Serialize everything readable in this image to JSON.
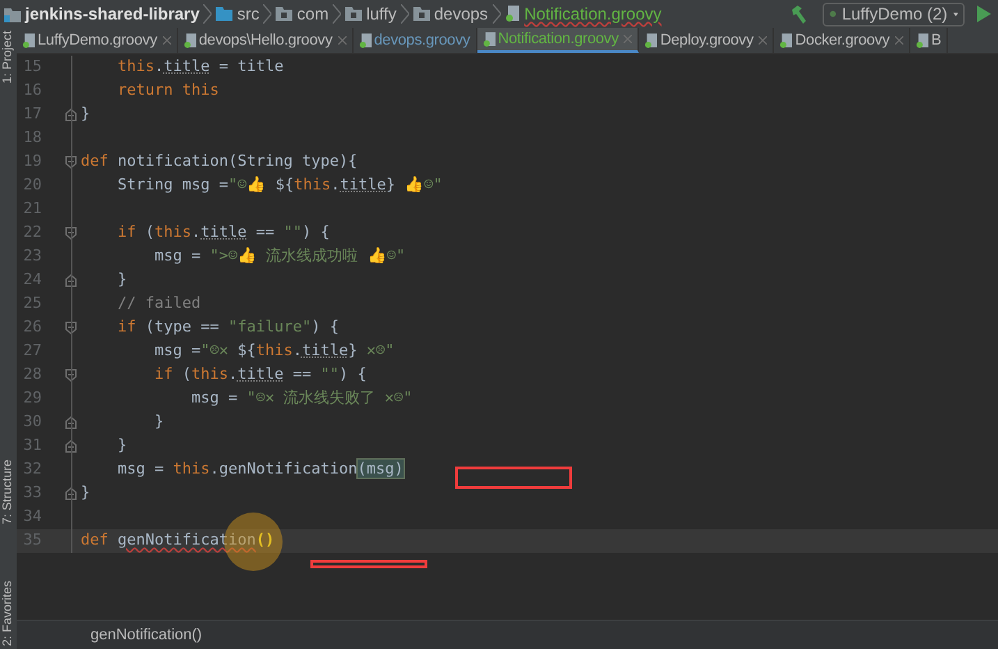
{
  "navbar": {
    "crumbs": [
      {
        "label": "jenkins-shared-library",
        "kind": "project"
      },
      {
        "label": "src",
        "kind": "folder"
      },
      {
        "label": "com",
        "kind": "package"
      },
      {
        "label": "luffy",
        "kind": "package"
      },
      {
        "label": "devops",
        "kind": "package"
      },
      {
        "label": "Notification.groovy",
        "kind": "file"
      }
    ],
    "run_config": "LuffyDemo (2)"
  },
  "tool_windows": [
    "1: Project",
    "7: Structure",
    "2: Favorites"
  ],
  "tabs": [
    {
      "label": "LuffyDemo.groovy",
      "color": "#bbbbbb",
      "selected": false,
      "closable": true
    },
    {
      "label": "devops\\Hello.groovy",
      "color": "#bbbbbb",
      "selected": false,
      "closable": true
    },
    {
      "label": "devops.groovy",
      "color": "#6897bb",
      "selected": false,
      "closable": false
    },
    {
      "label": "Notification.groovy",
      "color": "#62b543",
      "selected": true,
      "closable": true
    },
    {
      "label": "Deploy.groovy",
      "color": "#bbbbbb",
      "selected": false,
      "closable": true
    },
    {
      "label": "Docker.groovy",
      "color": "#bbbbbb",
      "selected": false,
      "closable": true
    },
    {
      "label": "B",
      "color": "#bbbbbb",
      "selected": false,
      "closable": false
    }
  ],
  "code_lines": [
    {
      "number": "15",
      "kind": "code",
      "current": false,
      "tokens": [
        {
          "kind": "kw",
          "text": "    this"
        },
        {
          "kind": "plain",
          "text": "."
        },
        {
          "kind": "prop",
          "text": "title"
        },
        {
          "kind": "plain",
          "text": " = title"
        }
      ]
    },
    {
      "number": "16",
      "kind": "code",
      "current": false,
      "tokens": [
        {
          "kind": "kw",
          "text": "    return this"
        }
      ]
    },
    {
      "number": "17",
      "kind": "fold_end",
      "current": false,
      "tokens": [
        {
          "kind": "plain",
          "text": "}"
        }
      ]
    },
    {
      "number": "18",
      "kind": "code",
      "current": false
    },
    {
      "number": "19",
      "kind": "fold_start",
      "current": false,
      "tokens": [
        {
          "kind": "kw",
          "text": "def"
        },
        {
          "kind": "plain",
          "text": " notification(String type){"
        }
      ]
    },
    {
      "number": "20",
      "kind": "code",
      "current": false,
      "tokens": [
        {
          "kind": "plain",
          "text": "    String msg ="
        },
        {
          "kind": "str",
          "text": "\"☺👍 "
        },
        {
          "kind": "plain",
          "text": "${"
        },
        {
          "kind": "kw",
          "text": "this"
        },
        {
          "kind": "plain",
          "text": "."
        },
        {
          "kind": "prop",
          "text": "title"
        },
        {
          "kind": "plain",
          "text": "}"
        },
        {
          "kind": "str",
          "text": " 👍☺\""
        }
      ]
    },
    {
      "number": "21",
      "kind": "code",
      "current": false
    },
    {
      "number": "22",
      "kind": "fold_start",
      "current": false,
      "tokens": [
        {
          "kind": "kw",
          "text": "    if"
        },
        {
          "kind": "plain",
          "text": " ("
        },
        {
          "kind": "kw",
          "text": "this"
        },
        {
          "kind": "plain",
          "text": "."
        },
        {
          "kind": "prop",
          "text": "title"
        },
        {
          "kind": "plain",
          "text": " == "
        },
        {
          "kind": "str",
          "text": "\"\""
        },
        {
          "kind": "plain",
          "text": ") {"
        }
      ]
    },
    {
      "number": "23",
      "kind": "code",
      "current": false,
      "tokens": [
        {
          "kind": "plain",
          "text": "        msg = "
        },
        {
          "kind": "str",
          "text": "\">☺👍 流水线成功啦 👍☺\""
        }
      ]
    },
    {
      "number": "24",
      "kind": "fold_end",
      "current": false,
      "tokens": [
        {
          "kind": "plain",
          "text": "    }"
        }
      ]
    },
    {
      "number": "25",
      "kind": "code",
      "current": false,
      "tokens": [
        {
          "kind": "comment",
          "text": "    // failed"
        }
      ]
    },
    {
      "number": "26",
      "kind": "fold_start",
      "current": false,
      "tokens": [
        {
          "kind": "kw",
          "text": "    if"
        },
        {
          "kind": "plain",
          "text": " (type == "
        },
        {
          "kind": "str",
          "text": "\"failure\""
        },
        {
          "kind": "plain",
          "text": ") {"
        }
      ]
    },
    {
      "number": "27",
      "kind": "code",
      "current": false,
      "tokens": [
        {
          "kind": "plain",
          "text": "        msg ="
        },
        {
          "kind": "str",
          "text": "\"☹✕ "
        },
        {
          "kind": "plain",
          "text": "${"
        },
        {
          "kind": "kw",
          "text": "this"
        },
        {
          "kind": "plain",
          "text": "."
        },
        {
          "kind": "prop",
          "text": "title"
        },
        {
          "kind": "plain",
          "text": "}"
        },
        {
          "kind": "str",
          "text": " ✕☹\""
        }
      ]
    },
    {
      "number": "28",
      "kind": "fold_start",
      "current": false,
      "tokens": [
        {
          "kind": "kw",
          "text": "        if"
        },
        {
          "kind": "plain",
          "text": " ("
        },
        {
          "kind": "kw",
          "text": "this"
        },
        {
          "kind": "plain",
          "text": "."
        },
        {
          "kind": "prop",
          "text": "title"
        },
        {
          "kind": "plain",
          "text": " == "
        },
        {
          "kind": "str",
          "text": "\"\""
        },
        {
          "kind": "plain",
          "text": ") {"
        }
      ]
    },
    {
      "number": "29",
      "kind": "code",
      "current": false,
      "tokens": [
        {
          "kind": "plain",
          "text": "            msg = "
        },
        {
          "kind": "str",
          "text": "\"☹✕ 流水线失败了 ✕☹\""
        }
      ]
    },
    {
      "number": "30",
      "kind": "fold_end",
      "current": false,
      "tokens": [
        {
          "kind": "plain",
          "text": "        }"
        }
      ]
    },
    {
      "number": "31",
      "kind": "fold_end",
      "current": false,
      "tokens": [
        {
          "kind": "plain",
          "text": "    }"
        }
      ]
    },
    {
      "number": "32",
      "kind": "code",
      "current": false,
      "tokens": [
        {
          "kind": "plain",
          "text": "    msg = "
        },
        {
          "kind": "kw",
          "text": "this"
        },
        {
          "kind": "plain",
          "text": ".genNotification"
        },
        {
          "kind": "match",
          "text": "(msg)"
        }
      ]
    },
    {
      "number": "33",
      "kind": "fold_end",
      "current": false,
      "tokens": [
        {
          "kind": "plain",
          "text": "}"
        }
      ]
    },
    {
      "number": "34",
      "kind": "code",
      "current": false
    },
    {
      "number": "35",
      "kind": "code",
      "current": true,
      "tokens": [
        {
          "kind": "kw",
          "text": "def "
        },
        {
          "kind": "error",
          "text": "genNotification"
        },
        {
          "kind": "brace",
          "text": "()"
        }
      ]
    }
  ],
  "editor_breadcrumb": "genNotification()"
}
